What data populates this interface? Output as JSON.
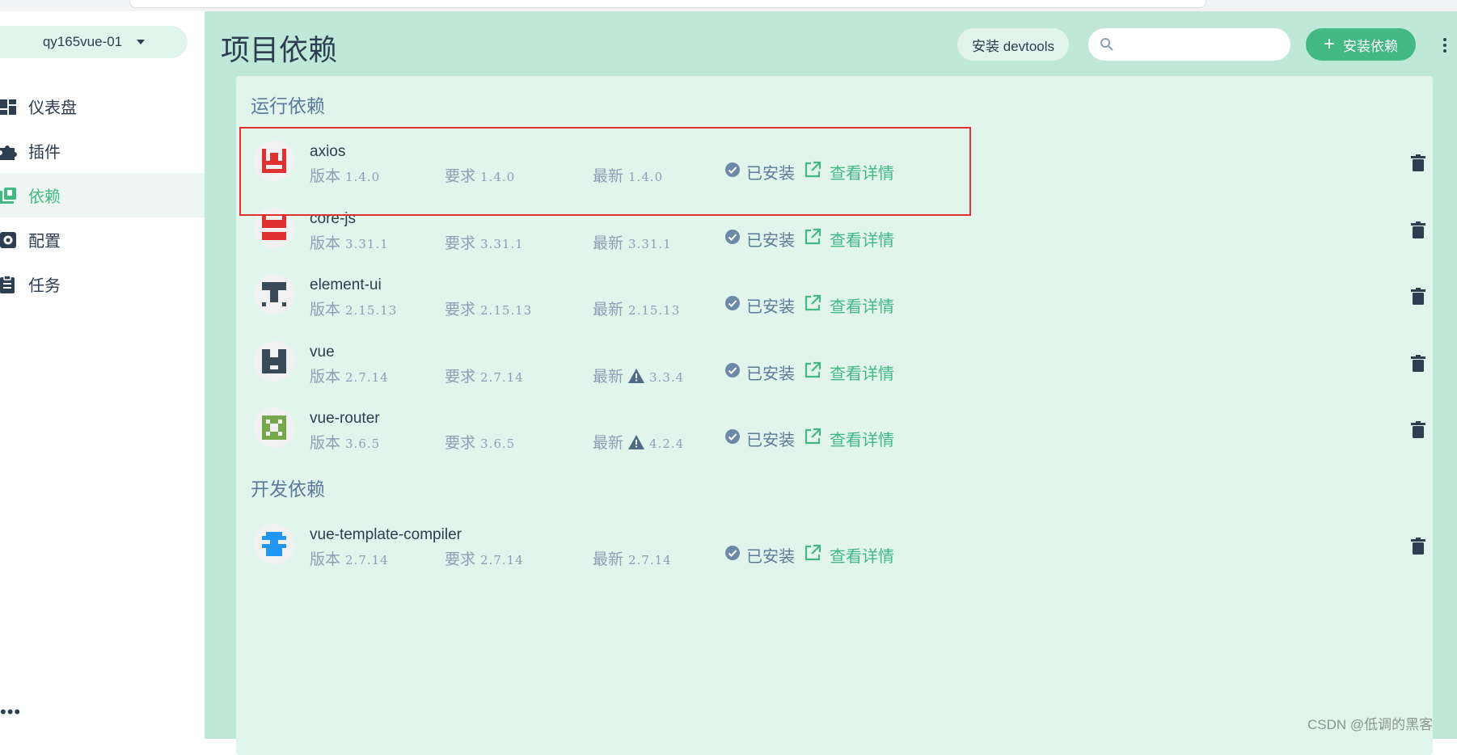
{
  "project": {
    "name": "qy165vue-01"
  },
  "nav": {
    "items": [
      {
        "label": "仪表盘",
        "icon": "dashboard-icon"
      },
      {
        "label": "插件",
        "icon": "puzzle-icon"
      },
      {
        "label": "依赖",
        "icon": "library-icon",
        "active": true
      },
      {
        "label": "配置",
        "icon": "gear-icon"
      },
      {
        "label": "任务",
        "icon": "clipboard-icon"
      }
    ],
    "more": "•••"
  },
  "header": {
    "title": "项目依赖",
    "devtools_label": "安装 devtools",
    "search_placeholder": "",
    "install_label": "安装依赖"
  },
  "labels": {
    "version": "版本",
    "required": "要求",
    "latest": "最新",
    "installed": "已安装",
    "details": "查看详情"
  },
  "sections": [
    {
      "title": "运行依赖",
      "deps": [
        {
          "name": "axios",
          "version": "1.4.0",
          "required": "1.4.0",
          "latest": "1.4.0",
          "outdated": false
        },
        {
          "name": "core-js",
          "version": "3.31.1",
          "required": "3.31.1",
          "latest": "3.31.1",
          "outdated": false
        },
        {
          "name": "element-ui",
          "version": "2.15.13",
          "required": "2.15.13",
          "latest": "2.15.13",
          "outdated": false
        },
        {
          "name": "vue",
          "version": "2.7.14",
          "required": "2.7.14",
          "latest": "3.3.4",
          "outdated": true
        },
        {
          "name": "vue-router",
          "version": "3.6.5",
          "required": "3.6.5",
          "latest": "4.2.4",
          "outdated": true
        }
      ]
    },
    {
      "title": "开发依赖",
      "deps": [
        {
          "name": "vue-template-compiler",
          "version": "2.7.14",
          "required": "2.7.14",
          "latest": "2.7.14",
          "outdated": false
        }
      ]
    }
  ],
  "colors": {
    "accent": "#42b983",
    "main_bg": "#bfe8d8",
    "panel_bg": "#e1f5ed",
    "highlight": "#e03131"
  },
  "watermark": "CSDN @低调的黑客"
}
